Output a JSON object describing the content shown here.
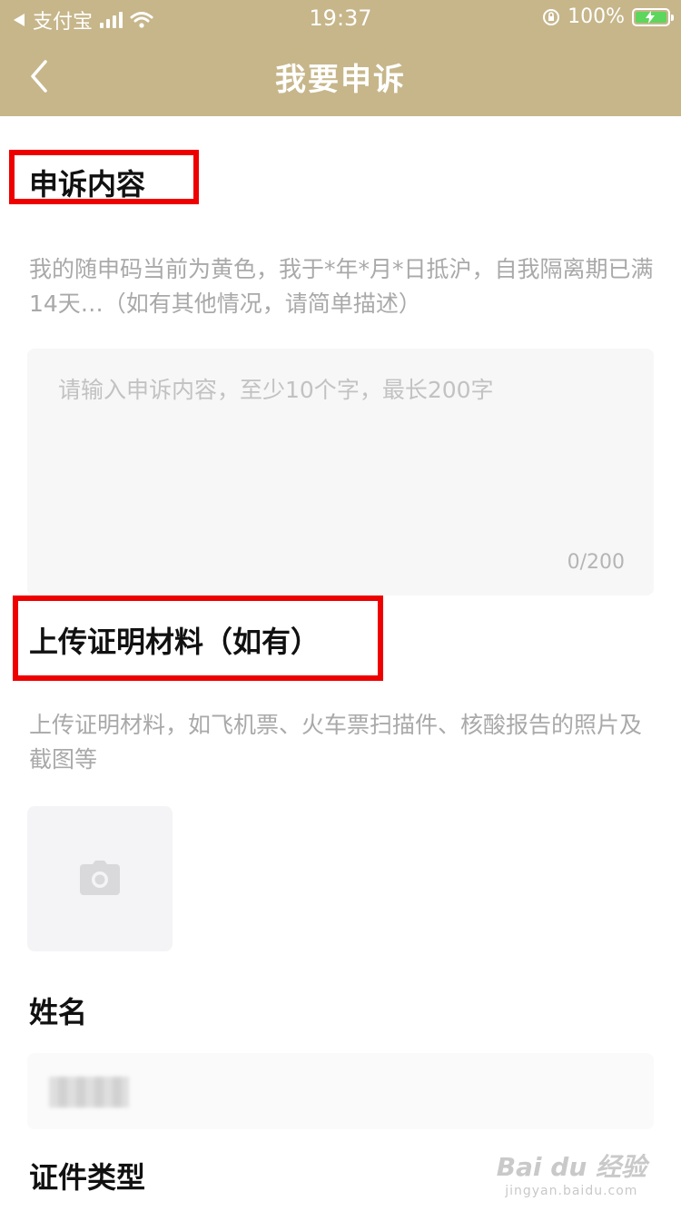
{
  "status_bar": {
    "carrier": "支付宝",
    "time": "19:37",
    "battery": "100%"
  },
  "nav": {
    "title": "我要申诉"
  },
  "complaint": {
    "title": "申诉内容",
    "hint": "我的随申码当前为黄色，我于*年*月*日抵沪，自我隔离期已满14天…（如有其他情况，请简单描述）",
    "placeholder": "请输入申诉内容，至少10个字，最长200字",
    "counter": "0/200"
  },
  "upload": {
    "title": "上传证明材料（如有）",
    "hint": "上传证明材料，如飞机票、火车票扫描件、核酸报告的照片及截图等"
  },
  "name": {
    "title": "姓名"
  },
  "id_type": {
    "title": "证件类型"
  },
  "watermark": {
    "brand": "Bai du 经验",
    "site": "jingyan.baidu.com"
  },
  "colors": {
    "header": "#c6b68a",
    "highlight": "#ee0000"
  }
}
